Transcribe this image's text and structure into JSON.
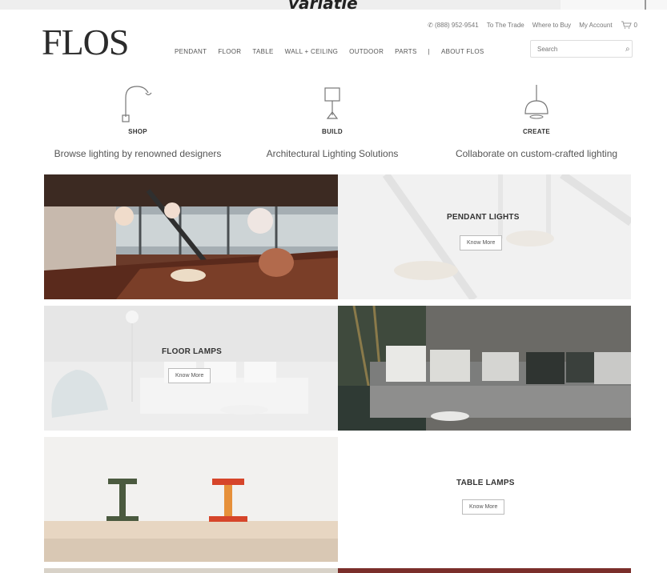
{
  "overlay": {
    "title": "variatie"
  },
  "header": {
    "logo": "FLOS",
    "utility": {
      "phone": "(888) 952-9541",
      "trade": "To The Trade",
      "where": "Where to Buy",
      "account": "My Account",
      "cart_count": "0"
    },
    "nav": [
      "PENDANT",
      "FLOOR",
      "TABLE",
      "WALL + CEILING",
      "OUTDOOR",
      "PARTS",
      "|",
      "ABOUT FLOS"
    ],
    "search_placeholder": "Search"
  },
  "features": [
    {
      "title": "SHOP",
      "desc": "Browse lighting by renowned designers",
      "icon": "arc-lamp-icon"
    },
    {
      "title": "BUILD",
      "desc": "Architectural Lighting Solutions",
      "icon": "table-lamp-icon"
    },
    {
      "title": "CREATE",
      "desc": "Collaborate on custom-crafted lighting",
      "icon": "pendant-lamp-icon"
    }
  ],
  "tiles": {
    "pendant": {
      "label": "PENDANT LIGHTS",
      "button": "Know More"
    },
    "floor": {
      "label": "FLOOR LAMPS",
      "button": "Know More"
    },
    "table": {
      "label": "TABLE LAMPS",
      "button": "Know More"
    }
  },
  "colors": {
    "accent": "#333333",
    "tile_bg": "#f3f3f3"
  }
}
